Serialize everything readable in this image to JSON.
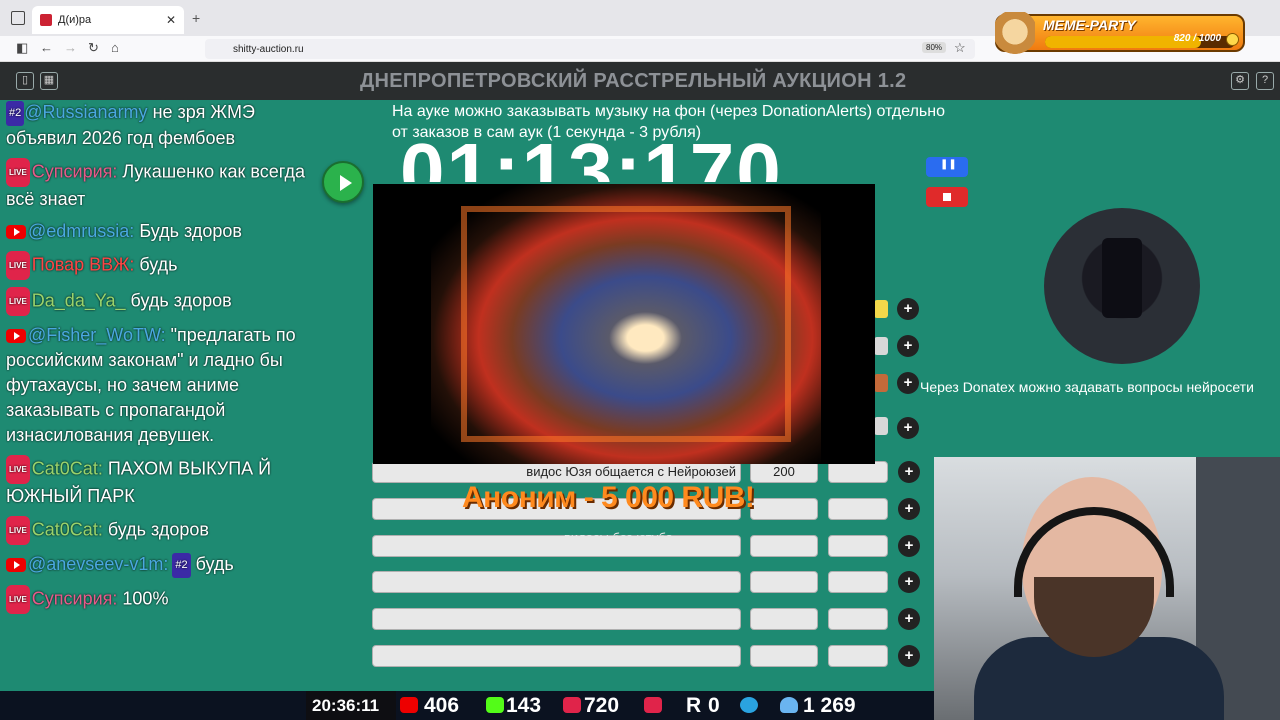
{
  "browser": {
    "tab_title": "Д(и)ра",
    "tab_close": "✕",
    "new_tab": "+",
    "url": "shitty-auction.ru",
    "zoom": "80%"
  },
  "meme_party": {
    "title": "MEME-PARTY",
    "score": "820 / 1000",
    "progress": 0.82
  },
  "app": {
    "title": "ДНЕПРОПЕТРОВСКИЙ РАССТРЕЛЬНЫЙ АУКЦИОН 1.2"
  },
  "chat": [
    {
      "badge": "rank",
      "rank": "#2",
      "author": "@Russianarmy",
      "author_color": "blue",
      "text": " не зря ЖМЭ объявил 2026 год фембоев"
    },
    {
      "badge": "live",
      "author": "Супсирия:",
      "author_color": "pink",
      "text": " Лукашенко как всегда всё знает"
    },
    {
      "badge": "yt",
      "author": "@edmrussia:",
      "author_color": "blue",
      "text": " Будь здоров"
    },
    {
      "badge": "live",
      "author": "Повар ВВЖ:",
      "author_color": "red",
      "text": " будь"
    },
    {
      "badge": "live",
      "author": "Da_da_Ya_",
      "author_color": "green",
      "text": " будь здоров"
    },
    {
      "badge": "yt",
      "author": "@Fisher_WoTW:",
      "author_color": "blue",
      "text": " \"предлагать по российским законам\" и ладно бы футахаусы, но зачем аниме заказывать с пропагандой изнасилования девушек."
    },
    {
      "badge": "live",
      "author": "Cat0Cat:",
      "author_color": "green",
      "text": " ПАХОМ ВЫКУПА Й ЮЖНЫЙ ПАРК"
    },
    {
      "badge": "live",
      "author": "Cat0Cat:",
      "author_color": "green",
      "text": " будь здоров"
    },
    {
      "badge": "yt",
      "author": "@anevseev-v1m:",
      "author_color": "blue",
      "text": " будь",
      "rank": "#2"
    },
    {
      "badge": "live",
      "author": "Супсирия:",
      "author_color": "pink",
      "text": " 100%"
    }
  ],
  "auction": {
    "announcement": "На ауке можно заказывать музыку на фон (через DonationAlerts) отдельно от заказов в сам аук (1 секунда - 3 рубля)",
    "timer": "01:13:170",
    "lots": [
      {
        "name": "видос Юзя общается с Нейроюзей",
        "amount": "200"
      },
      {
        "name": "",
        "amount": ""
      },
      {
        "name": "",
        "amount": ""
      },
      {
        "name": "",
        "amount": ""
      },
      {
        "name": "",
        "amount": ""
      },
      {
        "name": "",
        "amount": ""
      }
    ],
    "plus_label": "+"
  },
  "donation": {
    "headline": "Аноним - 5 000 RUB!",
    "message": "видосы без ютуба"
  },
  "donatex_note": "Через Donatex можно задавать вопросы нейросети",
  "stats": {
    "clock": "20:36:11",
    "youtube": "406",
    "kick": "143",
    "live": "720",
    "rutube": "0",
    "telegram": "",
    "viewers": "1 269"
  }
}
